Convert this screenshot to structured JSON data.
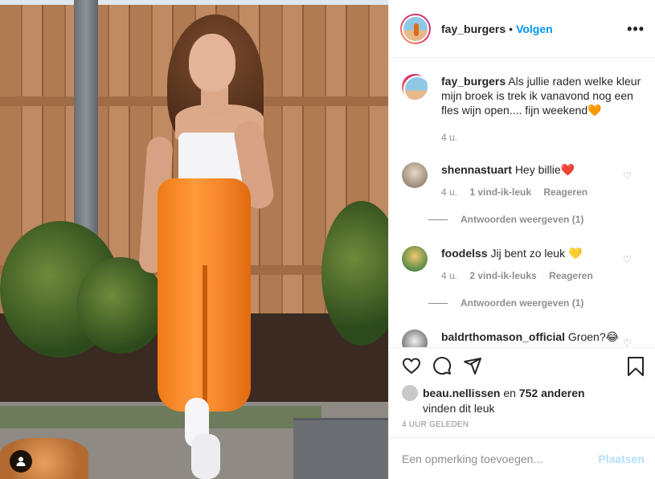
{
  "header": {
    "username": "fay_burgers",
    "separator": "•",
    "follow_label": "Volgen",
    "more_icon": "more-horizontal-icon"
  },
  "caption": {
    "username": "fay_burgers",
    "text": "Als jullie raden welke kleur mijn broek is trek ik vanavond nog een fles wijn open.... fijn weekend🧡",
    "time": "4 u."
  },
  "comments": [
    {
      "username": "shennastuart",
      "text": "Hey billie❤️",
      "time": "4 u.",
      "likes": "1 vind-ik-leuk",
      "reply": "Reageren",
      "view_replies": "Antwoorden weergeven (1)"
    },
    {
      "username": "foodelss",
      "text": "Jij bent zo leuk 💛",
      "time": "4 u.",
      "likes": "2 vind-ik-leuks",
      "reply": "Reageren",
      "view_replies": "Antwoorden weergeven (1)"
    },
    {
      "username": "baldrthomason_official",
      "text": "Groen?😂"
    }
  ],
  "likes": {
    "first_user": "beau.nellissen",
    "connector": "en",
    "others": "752 anderen",
    "suffix": "vinden dit leuk"
  },
  "timestamp": "4 UUR GELEDEN",
  "add_comment": {
    "placeholder": "Een opmerking toevoegen...",
    "post_label": "Plaatsen"
  },
  "colors": {
    "accent": "#0095f6",
    "post_disabled": "#b2dffc",
    "muted": "#8e8e8e",
    "heart_red": "#ed4956"
  }
}
